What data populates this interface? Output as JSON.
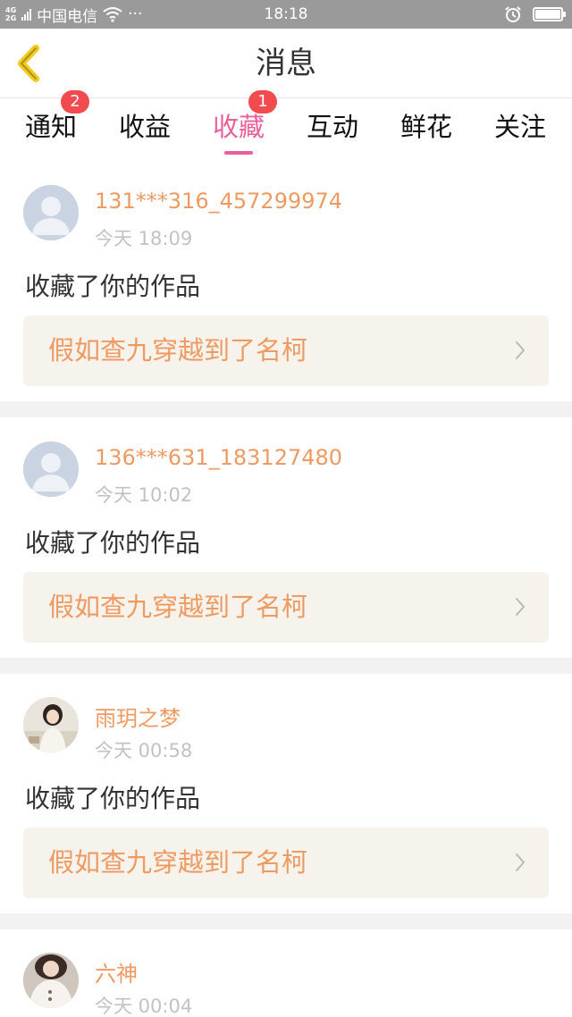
{
  "status_bar": {
    "network_type_top": "4G",
    "network_type_bottom": "2G",
    "carrier": "中国电信",
    "more": "···",
    "time": "18:18",
    "wifi_icon": "wifi-icon",
    "alarm_icon": "alarm-icon",
    "battery_level": 1.0
  },
  "header": {
    "title": "消息",
    "back_icon": "chevron-left-icon",
    "accent_color": "#f3c91b"
  },
  "tabs": [
    {
      "label": "通知",
      "badge": "2",
      "active": false
    },
    {
      "label": "收益",
      "badge": "",
      "active": false
    },
    {
      "label": "收藏",
      "badge": "1",
      "active": true
    },
    {
      "label": "互动",
      "badge": "",
      "active": false
    },
    {
      "label": "鲜花",
      "badge": "",
      "active": false
    },
    {
      "label": "关注",
      "badge": "",
      "active": false
    }
  ],
  "colors": {
    "active_tab": "#e9609a",
    "badge": "#f14a4f",
    "username": "#ee9a62",
    "work_title": "#ee9a62"
  },
  "messages": [
    {
      "username": "131***316_457299974",
      "time": "今天 18:09",
      "action": "收藏了你的作品",
      "work_title": "假如查九穿越到了名柯",
      "avatar": "default-avatar-icon"
    },
    {
      "username": "136***631_183127480",
      "time": "今天 10:02",
      "action": "收藏了你的作品",
      "work_title": "假如查九穿越到了名柯",
      "avatar": "default-avatar-icon"
    },
    {
      "username": "雨玥之梦",
      "time": "今天 00:58",
      "action": "收藏了你的作品",
      "work_title": "假如查九穿越到了名柯",
      "avatar": "user-photo-avatar"
    },
    {
      "username": "六神",
      "time": "今天 00:04",
      "action": "",
      "work_title": "",
      "avatar": "user-photo-avatar"
    }
  ]
}
